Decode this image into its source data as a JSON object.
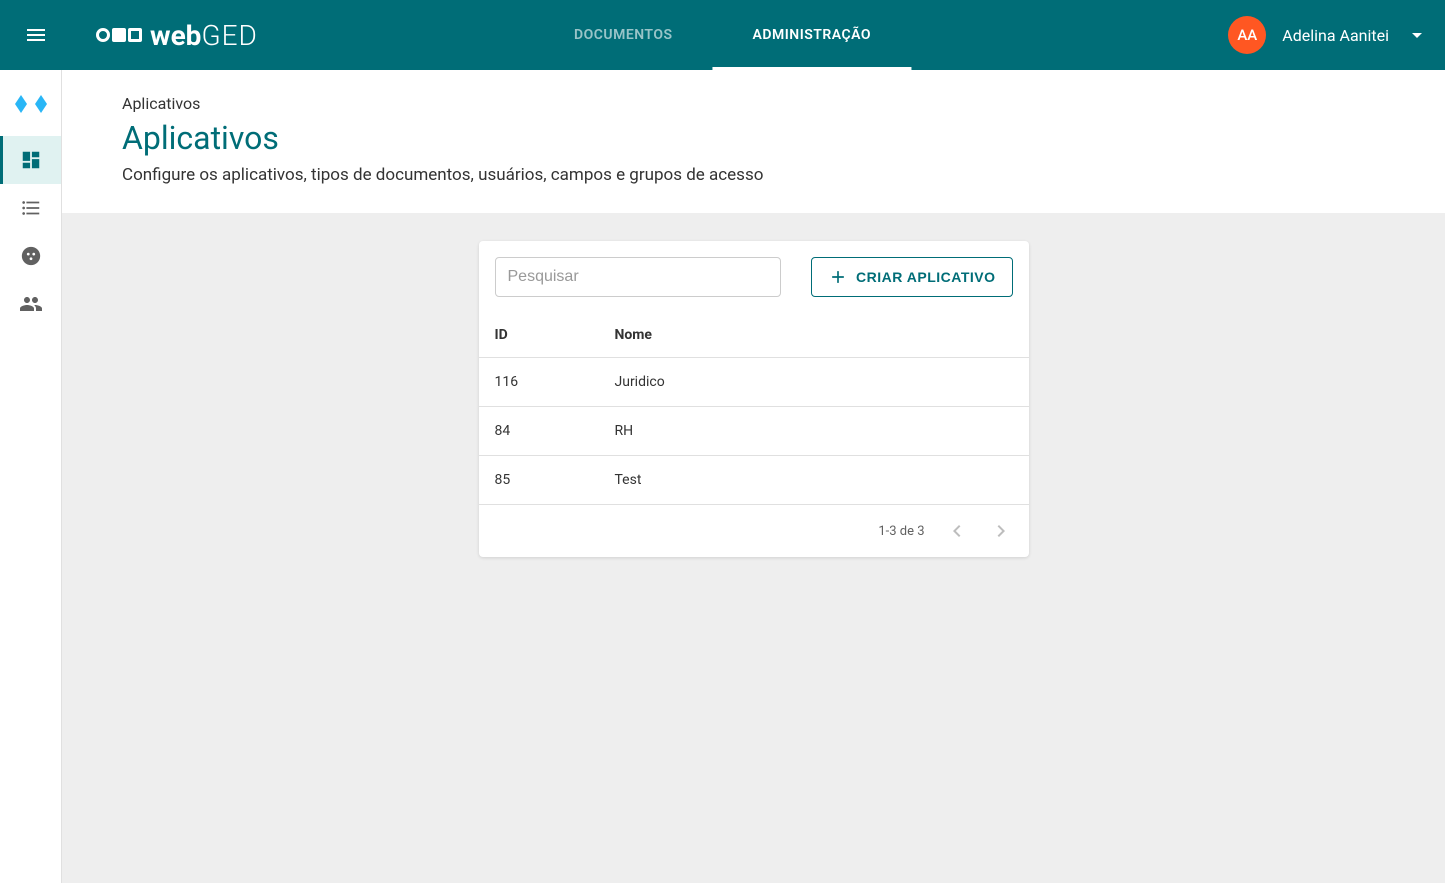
{
  "header": {
    "navTabs": [
      {
        "label": "DOCUMENTOS",
        "active": false
      },
      {
        "label": "ADMINISTRAÇÃO",
        "active": true
      }
    ],
    "user": {
      "initials": "AA",
      "name": "Adelina Aanitei"
    }
  },
  "page": {
    "breadcrumb": "Aplicativos",
    "title": "Aplicativos",
    "subtitle": "Configure os aplicativos, tipos de documentos, usuários, campos e grupos de acesso"
  },
  "card": {
    "searchPlaceholder": "Pesquisar",
    "createLabel": "CRIAR APLICATIVO",
    "columns": {
      "id": "ID",
      "name": "Nome"
    },
    "rows": [
      {
        "id": "116",
        "name": "Juridico"
      },
      {
        "id": "84",
        "name": "RH"
      },
      {
        "id": "85",
        "name": "Test"
      }
    ],
    "pagination": "1-3 de 3"
  }
}
